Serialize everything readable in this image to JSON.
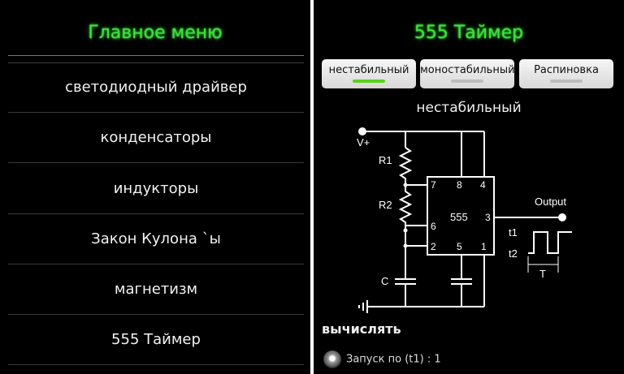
{
  "left": {
    "title": "Главное меню",
    "items": [
      {
        "label": "светодиодный драйвер"
      },
      {
        "label": "конденсаторы"
      },
      {
        "label": "индукторы"
      },
      {
        "label": "Закон Кулона `ы"
      },
      {
        "label": "магнетизм"
      },
      {
        "label": "555 Таймер"
      }
    ]
  },
  "right": {
    "title": "555 Таймер",
    "tabs": [
      {
        "label": "нестабильный",
        "active": true
      },
      {
        "label": "моностабильный",
        "active": false
      },
      {
        "label": "Распиновка",
        "active": false
      }
    ],
    "mode_title": "нестабильный",
    "schematic": {
      "vplus": "V+",
      "r1": "R1",
      "r2": "R2",
      "c": "C",
      "chip": "555",
      "pins": [
        "7",
        "8",
        "4",
        "6",
        "3",
        "2",
        "5",
        "1"
      ],
      "output": "Output",
      "t1": "t1",
      "t2": "t2",
      "T": "T"
    },
    "calculate_label": "вычислять",
    "radio_label": "Запуск по (t1) : 1"
  },
  "colors": {
    "title_green": "#3ce03c",
    "active_indicator": "#5ad21a",
    "background": "#000000"
  }
}
